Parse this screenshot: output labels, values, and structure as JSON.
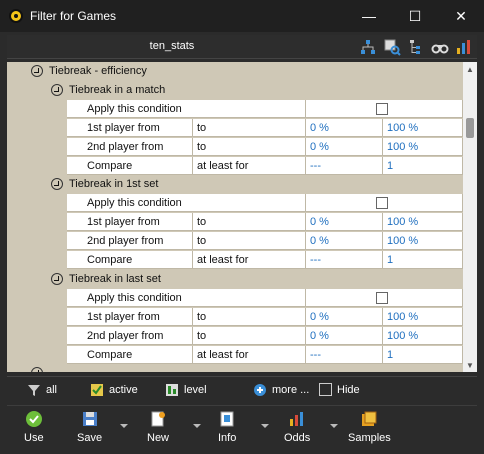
{
  "window": {
    "title": "Filter for Games",
    "minimize": "—",
    "maximize": "☐",
    "close": "✕"
  },
  "toolbar": {
    "title": "ten_stats",
    "icons": [
      "tree-icon",
      "settings-search-icon",
      "hierarchy-icon",
      "binoculars-icon",
      "bar-chart-icon"
    ]
  },
  "grid": {
    "group_title": "Tiebreak - efficiency",
    "sections": [
      {
        "title": "Tiebreak in a match",
        "rows": [
          {
            "label": "Apply this condition",
            "type": "checkbox",
            "checked": false
          },
          {
            "label": "1st player from",
            "mid": "to",
            "v1": "0 %",
            "v2": "100 %"
          },
          {
            "label": "2nd player from",
            "mid": "to",
            "v1": "0 %",
            "v2": "100 %"
          },
          {
            "label": "Compare",
            "mid": "at least for",
            "v1": "---",
            "v2": "1"
          }
        ]
      },
      {
        "title": "Tiebreak in 1st set",
        "rows": [
          {
            "label": "Apply this condition",
            "type": "checkbox",
            "checked": false
          },
          {
            "label": "1st player from",
            "mid": "to",
            "v1": "0 %",
            "v2": "100 %"
          },
          {
            "label": "2nd player from",
            "mid": "to",
            "v1": "0 %",
            "v2": "100 %"
          },
          {
            "label": "Compare",
            "mid": "at least for",
            "v1": "---",
            "v2": "1"
          }
        ]
      },
      {
        "title": "Tiebreak in last set",
        "rows": [
          {
            "label": "Apply this condition",
            "type": "checkbox",
            "checked": false
          },
          {
            "label": "1st player from",
            "mid": "to",
            "v1": "0 %",
            "v2": "100 %"
          },
          {
            "label": "2nd player from",
            "mid": "to",
            "v1": "0 %",
            "v2": "100 %"
          },
          {
            "label": "Compare",
            "mid": "at least for",
            "v1": "---",
            "v2": "1"
          }
        ]
      }
    ]
  },
  "filterbar": {
    "all": "all",
    "active": "active",
    "level": "level",
    "more": "more ...",
    "hide": "Hide"
  },
  "actions": {
    "use": "Use",
    "save": "Save",
    "new": "New",
    "info": "Info",
    "odds": "Odds",
    "samples": "Samples"
  },
  "colors": {
    "grid_bg": "#cfc8b6",
    "value_blue": "#1f6fbf",
    "window_bg": "#2b2b2b"
  }
}
